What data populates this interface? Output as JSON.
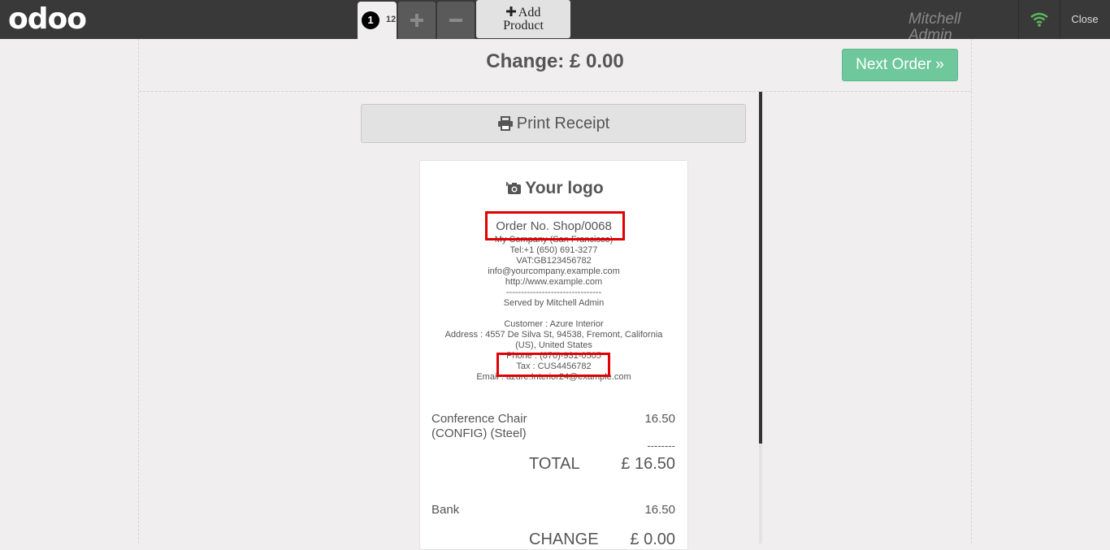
{
  "topbar": {
    "logo": "odoo",
    "order_tab": {
      "number": "1",
      "time": "12:"
    },
    "plus_label": "+",
    "minus_label": "−",
    "add_product_line1": "Add",
    "add_product_line2": "Product",
    "user_name": "Mitchell Admin",
    "close_label": "Close",
    "icons": {
      "plus": "plus-icon",
      "minus": "minus-icon",
      "wifi": "wifi-icon"
    }
  },
  "screen": {
    "change_title": "Change: £ 0.00",
    "next_order_label": "Next Order »",
    "print_receipt_label": "Print Receipt",
    "accent_color": "#6ec89b"
  },
  "receipt": {
    "logo_text": "Your logo",
    "order_no": "Order No. Shop/0068",
    "company": "My Company (San Francisco)",
    "tel": "Tel:+1 (650) 691-3277",
    "vat": "VAT:GB123456782",
    "email": "info@yourcompany.example.com",
    "website": "http://www.example.com",
    "separator": "--------------------------------",
    "served_by": "Served by Mitchell Admin",
    "customer": "Customer : Azure Interior",
    "address_line1": "Address : 4557 De Silva St, 94538, Fremont, California",
    "address_line2": "(US), United States",
    "phone": "Phone : (870)-931-0505",
    "tax": "Tax : CUS4456782",
    "customer_email": "Email : azure.Interior24@example.com",
    "lines": [
      {
        "name_line1": "Conference Chair",
        "name_line2": "(CONFIG) (Steel)",
        "price": "16.50"
      }
    ],
    "total_separator": "--------",
    "total_label": "TOTAL",
    "total_amount": "£ 16.50",
    "payment_label": "Bank",
    "payment_amount": "16.50",
    "change_label": "CHANGE",
    "change_amount": "£ 0.00"
  },
  "highlight_color": "#e00000"
}
